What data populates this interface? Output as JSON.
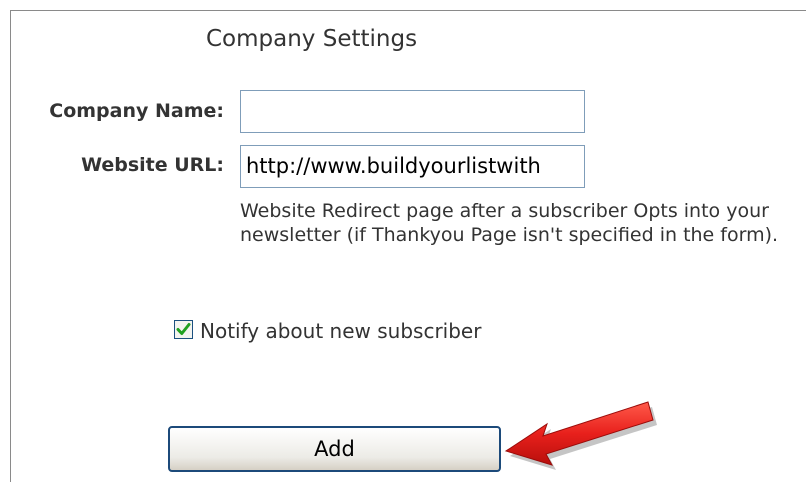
{
  "form": {
    "title": "Company Settings",
    "company_name_label": "Company Name:",
    "company_name_value": "",
    "website_url_label": "Website URL:",
    "website_url_value": "http://www.buildyourlistwith",
    "website_help": "Website Redirect page after a subscriber Opts into your newsletter (if Thankyou Page isn't specified in the form).",
    "notify_label": "Notify about new subscriber",
    "notify_checked": true,
    "add_button_label": "Add"
  },
  "colors": {
    "arrow": "#e8201c",
    "input_border": "#7f9db9",
    "button_border": "#1c4a7a",
    "checkmark": "#21a121"
  },
  "icons": {
    "checkbox": "checkmark-icon",
    "annotation": "red-arrow-icon"
  }
}
